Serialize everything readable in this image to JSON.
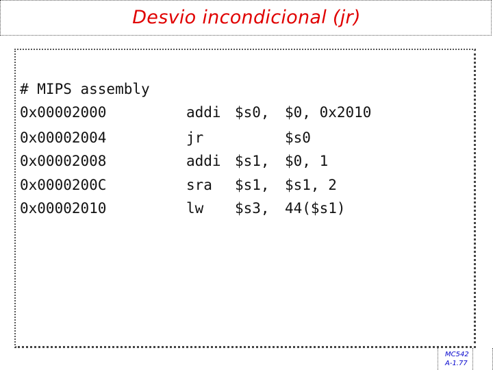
{
  "title": "Desvio incondicional (jr)",
  "comment": "# MIPS assembly",
  "rows": [
    {
      "address": "0x00002000",
      "op": "addi",
      "arg1": "$s0,",
      "arg2": "$0, 0x2010"
    },
    {
      "address": "0x00002004",
      "op": "jr",
      "arg1": "",
      "arg2": "$s0"
    },
    {
      "address": "0x00002008",
      "op": "addi",
      "arg1": "$s1,",
      "arg2": "$0, 1"
    },
    {
      "address": "0x0000200C",
      "op": "sra",
      "arg1": "$s1,",
      "arg2": "$s1, 2"
    },
    {
      "address": "0x00002010",
      "op": "lw",
      "arg1": "$s3,",
      "arg2": "44($s1)"
    }
  ],
  "footer": {
    "course": "MC542",
    "page": "A-1.77"
  },
  "colors": {
    "title": "#e00000",
    "footer": "#0000cc"
  }
}
